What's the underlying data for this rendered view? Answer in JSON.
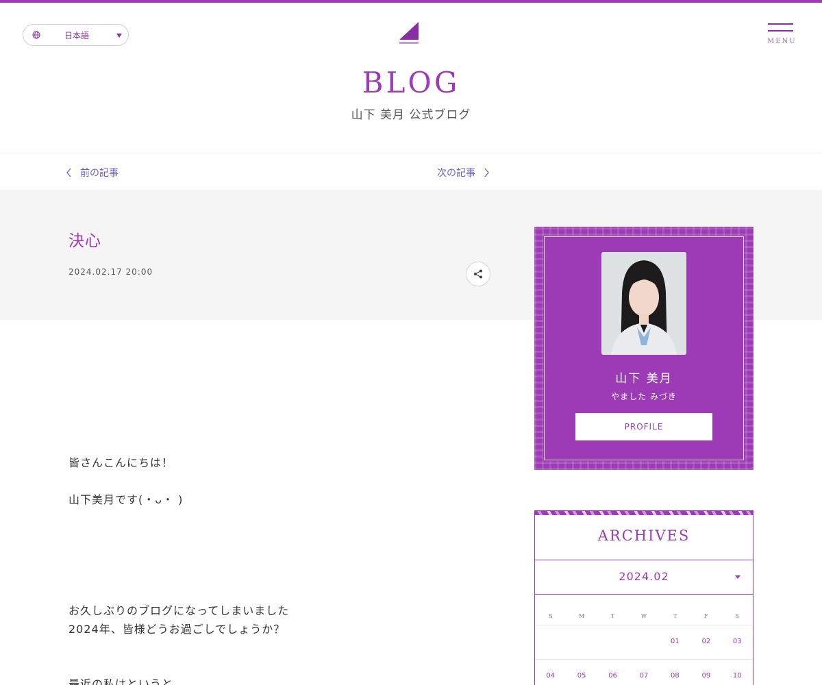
{
  "header": {
    "language": "日本語",
    "menu_label": "MENU",
    "title": "BLOG",
    "subtitle": "山下 美月 公式ブログ"
  },
  "article_nav": {
    "prev": "前の記事",
    "next": "次の記事"
  },
  "post": {
    "title": "決心",
    "date": "2024.02.17 20:00",
    "paragraphs": [
      "皆さんこんにちは！",
      "山下美月です(・ᴗ・ )",
      "お久しぶりのブログになってしまいました",
      "2024年、皆様どうお過ごしでしょうか？",
      "最近の私はというと"
    ]
  },
  "profile": {
    "name": "山下 美月",
    "kana": "やました みづき",
    "button": "PROFILE"
  },
  "archives": {
    "title": "ARCHIVES",
    "month": "2024.02",
    "weekdays": [
      "S",
      "M",
      "T",
      "W",
      "T",
      "F",
      "S"
    ],
    "week1": [
      "",
      "",
      "",
      "",
      "01",
      "02",
      "03"
    ],
    "week2": [
      "04",
      "05",
      "06",
      "07",
      "08",
      "09",
      "10"
    ]
  },
  "colors": {
    "accent": "#9c3bb5",
    "nav_link": "#6b5fc5",
    "gray_bg": "#f5f5f5"
  },
  "icons": [
    "globe-icon",
    "caret-down-icon",
    "logo",
    "hamburger-icon",
    "chevron-left-icon",
    "chevron-right-icon",
    "share-icon"
  ]
}
